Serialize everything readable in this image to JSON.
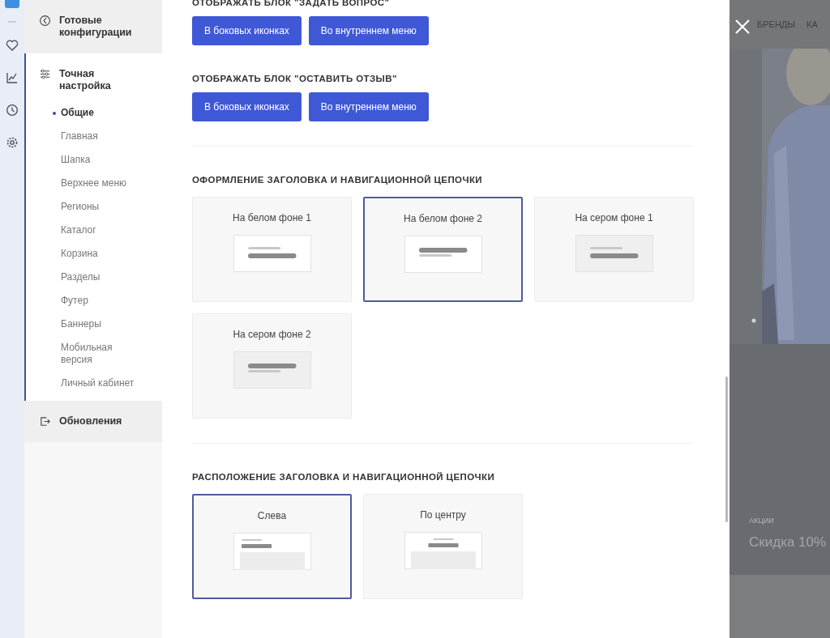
{
  "sidebar": {
    "sections": [
      {
        "label": "Готовые конфигурации",
        "expanded": false
      },
      {
        "label": "Точная настройка",
        "expanded": true,
        "children": [
          {
            "label": "Общие",
            "selected": true
          },
          {
            "label": "Главная",
            "selected": false
          },
          {
            "label": "Шапка",
            "selected": false
          },
          {
            "label": "Верхнее меню",
            "selected": false
          },
          {
            "label": "Регионы",
            "selected": false
          },
          {
            "label": "Каталог",
            "selected": false
          },
          {
            "label": "Корзина",
            "selected": false
          },
          {
            "label": "Разделы",
            "selected": false
          },
          {
            "label": "Футер",
            "selected": false
          },
          {
            "label": "Баннеры",
            "selected": false
          },
          {
            "label": "Мобильная версия",
            "selected": false
          },
          {
            "label": "Личный кабинет",
            "selected": false
          }
        ]
      },
      {
        "label": "Обновления",
        "expanded": false
      }
    ]
  },
  "settings": [
    {
      "kind": "buttons",
      "title": "ОТОБРАЖАТЬ БЛОК \"ЗАДАТЬ ВОПРОС\"",
      "buttons": [
        "В боковых иконках",
        "Во внутреннем меню"
      ]
    },
    {
      "kind": "buttons",
      "title": "ОТОБРАЖАТЬ БЛОК \"ОСТАВИТЬ ОТЗЫВ\"",
      "buttons": [
        "В боковых иконках",
        "Во внутреннем меню"
      ]
    },
    {
      "kind": "cards",
      "title": "ОФОРМЛЕНИЕ ЗАГОЛОВКА И НАВИГАЦИОННОЙ ЦЕПОЧКИ",
      "options": [
        {
          "label": "На белом фоне 1",
          "selected": false,
          "kind": "white"
        },
        {
          "label": "На белом фоне 2",
          "selected": true,
          "kind": "whiteinverted"
        },
        {
          "label": "На сером фоне 1",
          "selected": false,
          "kind": "grey"
        },
        {
          "label": "На сером фоне 2",
          "selected": false,
          "kind": "greyinverted"
        }
      ]
    },
    {
      "kind": "layout",
      "title": "РАСПОЛОЖЕНИЕ ЗАГОЛОВКА И НАВИГАЦИОННОЙ ЦЕПОЧКИ",
      "options": [
        {
          "label": "Слева",
          "selected": true,
          "kind": "left"
        },
        {
          "label": "По центру",
          "selected": false,
          "kind": "center"
        }
      ]
    }
  ],
  "backdrop": {
    "nav": [
      "БРЕНДЫ",
      "КА"
    ],
    "promo_label": "АКЦИИ",
    "promo_title": "Скидка 10%"
  }
}
